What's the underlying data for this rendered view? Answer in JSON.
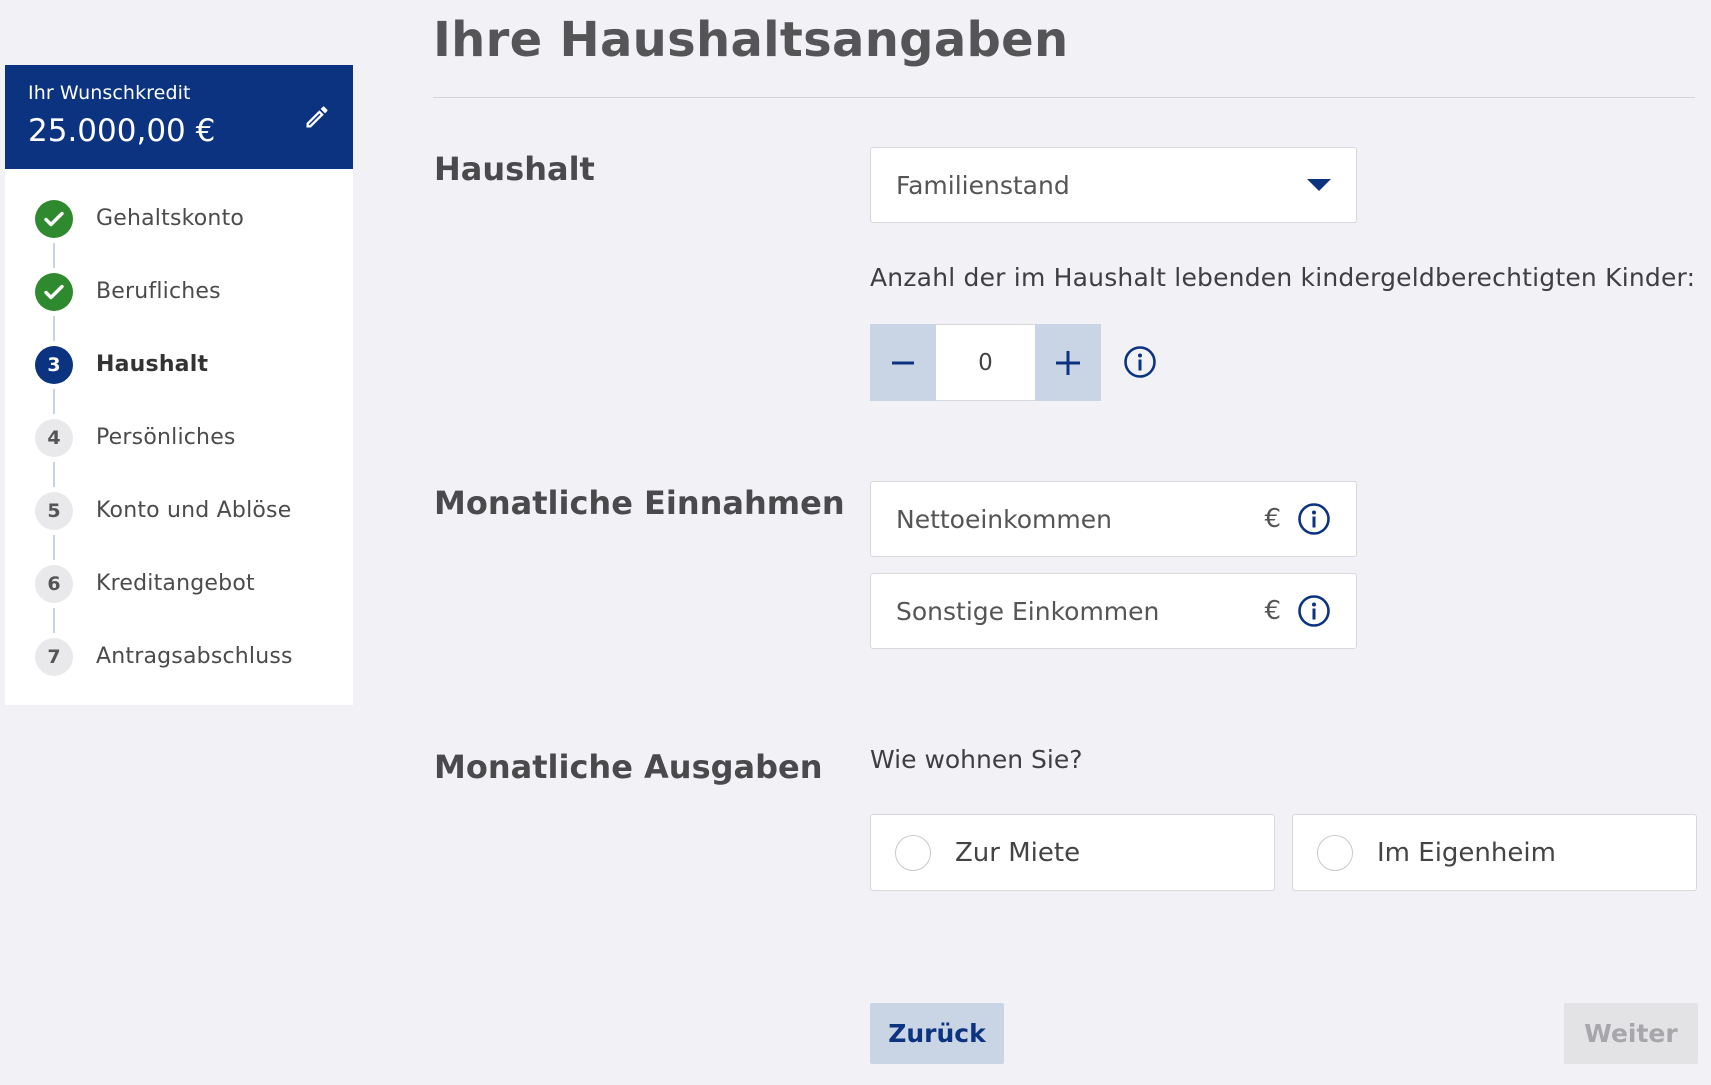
{
  "credit": {
    "label": "Ihr Wunschkredit",
    "amount": "25.000,00 €",
    "edit_icon": "pencil-icon"
  },
  "steps": [
    {
      "number": "",
      "label": "Gehaltskonto",
      "status": "done",
      "icon": "checkmark-icon"
    },
    {
      "number": "",
      "label": "Berufliches",
      "status": "done",
      "icon": "checkmark-icon"
    },
    {
      "number": "3",
      "label": "Haushalt",
      "status": "current"
    },
    {
      "number": "4",
      "label": "Persönliches",
      "status": "todo"
    },
    {
      "number": "5",
      "label": "Konto und Ablöse",
      "status": "todo"
    },
    {
      "number": "6",
      "label": "Kreditangebot",
      "status": "todo"
    },
    {
      "number": "7",
      "label": "Antragsabschluss",
      "status": "todo"
    }
  ],
  "page": {
    "title": "Ihre Haushaltsangaben"
  },
  "household": {
    "heading": "Haushalt",
    "marital_status_placeholder": "Familienstand",
    "children_label": "Anzahl der im Haushalt lebenden kindergeldberechtigten Kinder:",
    "children_value": "0",
    "minus_icon": "minus-icon",
    "plus_icon": "plus-icon",
    "info_icon": "info-icon"
  },
  "income": {
    "heading": "Monatliche Einnahmen",
    "net_income_placeholder": "Nettoeinkommen",
    "other_income_placeholder": "Sonstige Einkommen",
    "currency": "€"
  },
  "expenses": {
    "heading": "Monatliche Ausgaben",
    "question": "Wie wohnen Sie?",
    "options": [
      "Zur Miete",
      "Im Eigenheim"
    ]
  },
  "actions": {
    "back_label": "Zurück",
    "next_label": "Weiter"
  },
  "colors": {
    "brand": "#0b3380",
    "done": "#2f8a2f",
    "stepper_bg": "#c9d5e4",
    "page_bg": "#f2f2f6"
  }
}
